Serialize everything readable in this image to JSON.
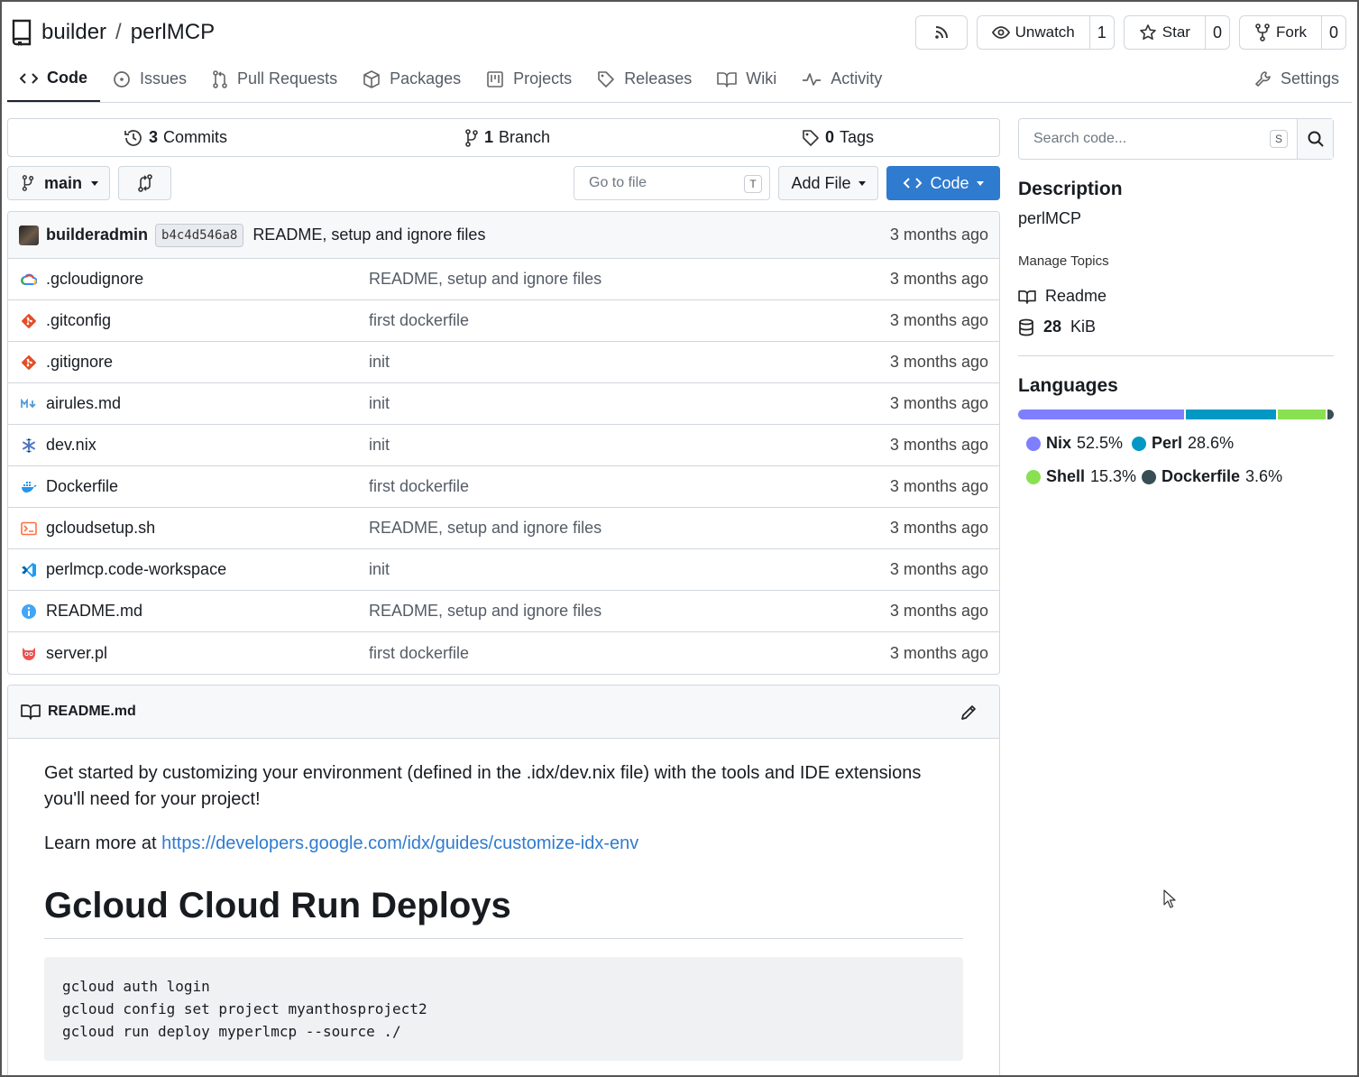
{
  "repo": {
    "owner": "builder",
    "separator": "/",
    "name": "perlMCP"
  },
  "actions": {
    "unwatch": {
      "label": "Unwatch",
      "count": "1"
    },
    "star": {
      "label": "Star",
      "count": "0"
    },
    "fork": {
      "label": "Fork",
      "count": "0"
    }
  },
  "tabs": [
    {
      "label": "Code",
      "icon": "code-icon",
      "active": true
    },
    {
      "label": "Issues",
      "icon": "issue-icon"
    },
    {
      "label": "Pull Requests",
      "icon": "pull-request-icon"
    },
    {
      "label": "Packages",
      "icon": "package-icon"
    },
    {
      "label": "Projects",
      "icon": "project-icon"
    },
    {
      "label": "Releases",
      "icon": "tag-icon"
    },
    {
      "label": "Wiki",
      "icon": "book-icon"
    },
    {
      "label": "Activity",
      "icon": "pulse-icon"
    },
    {
      "label": "Settings",
      "icon": "wrench-icon"
    }
  ],
  "stats": {
    "commits": {
      "count": "3",
      "label": "Commits"
    },
    "branches": {
      "count": "1",
      "label": "Branch"
    },
    "tags": {
      "count": "0",
      "label": "Tags"
    }
  },
  "toolbar": {
    "branch": "main",
    "goto_placeholder": "Go to file",
    "goto_key": "T",
    "add_file": "Add File",
    "code": "Code"
  },
  "latest_commit": {
    "author": "builderadmin",
    "sha": "b4c4d546a8",
    "message": "README, setup and ignore files",
    "time": "3 months ago"
  },
  "files": [
    {
      "name": ".gcloudignore",
      "message": "README, setup and ignore files",
      "time": "3 months ago",
      "icon": "gcloud-icon"
    },
    {
      "name": ".gitconfig",
      "message": "first dockerfile",
      "time": "3 months ago",
      "icon": "git-icon"
    },
    {
      "name": ".gitignore",
      "message": "init",
      "time": "3 months ago",
      "icon": "git-icon"
    },
    {
      "name": "airules.md",
      "message": "init",
      "time": "3 months ago",
      "icon": "markdown-icon"
    },
    {
      "name": "dev.nix",
      "message": "init",
      "time": "3 months ago",
      "icon": "nix-icon"
    },
    {
      "name": "Dockerfile",
      "message": "first dockerfile",
      "time": "3 months ago",
      "icon": "docker-icon"
    },
    {
      "name": "gcloudsetup.sh",
      "message": "README, setup and ignore files",
      "time": "3 months ago",
      "icon": "shell-icon"
    },
    {
      "name": "perlmcp.code-workspace",
      "message": "init",
      "time": "3 months ago",
      "icon": "vscode-icon"
    },
    {
      "name": "README.md",
      "message": "README, setup and ignore files",
      "time": "3 months ago",
      "icon": "info-icon"
    },
    {
      "name": "server.pl",
      "message": "first dockerfile",
      "time": "3 months ago",
      "icon": "perl-icon"
    }
  ],
  "readme": {
    "filename": "README.md",
    "intro": "Get started by customizing your environment (defined in the .idx/dev.nix file) with the tools and IDE extensions you'll need for your project!",
    "learn_prefix": "Learn more at ",
    "learn_link": "https://developers.google.com/idx/guides/customize-idx-env",
    "heading": "Gcloud Cloud Run Deploys",
    "code": "gcloud auth login\ngcloud config set project myanthosproject2\ngcloud run deploy myperlmcp --source ./"
  },
  "sidebar": {
    "search_placeholder": "Search code...",
    "search_key": "S",
    "description_title": "Description",
    "description": "perlMCP",
    "manage_topics": "Manage Topics",
    "readme": "Readme",
    "size_value": "28",
    "size_unit": "KiB",
    "languages_title": "Languages",
    "languages": [
      {
        "name": "Nix",
        "percent": "52.5%",
        "share": 52.5,
        "color": "#7e7eff"
      },
      {
        "name": "Perl",
        "percent": "28.6%",
        "share": 28.6,
        "color": "#0298c3"
      },
      {
        "name": "Shell",
        "percent": "15.3%",
        "share": 15.3,
        "color": "#89e051"
      },
      {
        "name": "Dockerfile",
        "percent": "3.6%",
        "share": 3.6,
        "color": "#384d54"
      }
    ]
  },
  "colors": {
    "accent": "#2f7bcf",
    "border": "#d0d7de"
  }
}
